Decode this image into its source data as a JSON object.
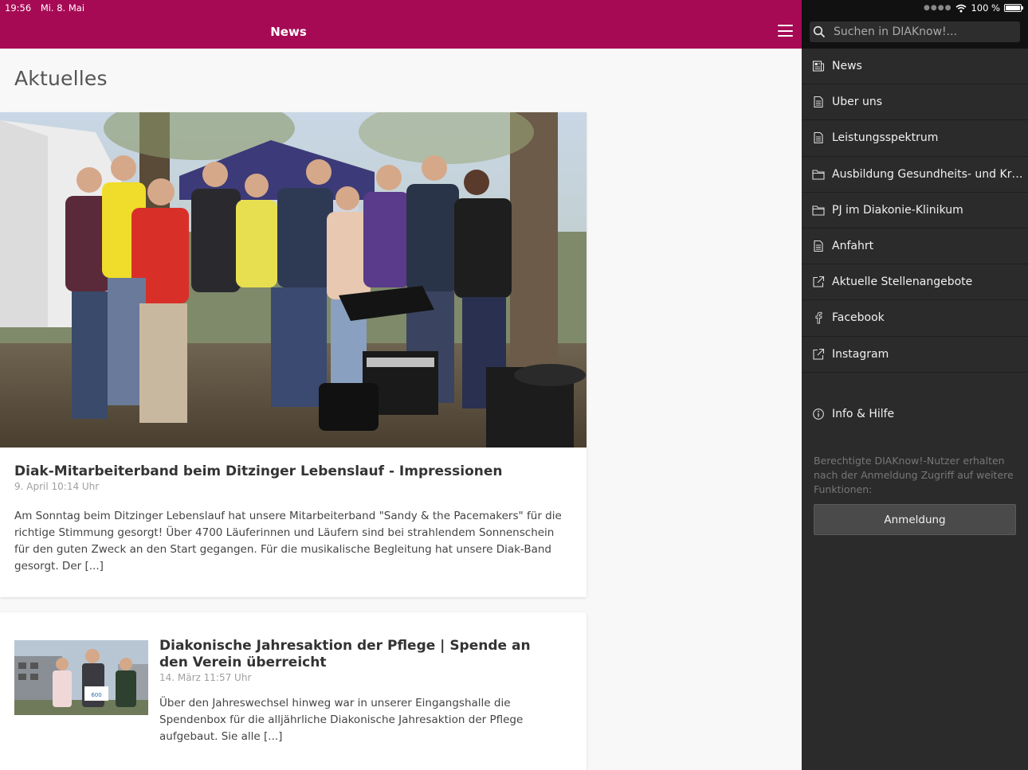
{
  "status_bar": {
    "time": "19:56",
    "date": "Mi. 8. Mai",
    "battery": "100 %"
  },
  "header": {
    "title": "News"
  },
  "page": {
    "heading": "Aktuelles"
  },
  "articles": [
    {
      "title": "Diak-Mitarbeiterband beim Ditzinger Lebenslauf - Impressionen",
      "date": "9. April 10:14 Uhr",
      "excerpt": "Am Sonntag beim Ditzinger Lebenslauf hat unsere Mitarbeiterband \"Sandy & the Pacemakers\" für die richtige Stimmung gesorgt! Über 4700 Läuferinnen und Läufern sind bei strahlendem Sonnenschein für den guten Zweck an den Start gegangen. Für die musikalische Begleitung hat unsere Diak-Band gesorgt. Der [...]"
    },
    {
      "title": "Diakonische Jahresaktion der Pflege | Spende an den Verein überreicht",
      "date": "14. März 11:57 Uhr",
      "excerpt": "Über den Jahreswechsel hinweg war in unserer Eingangshalle die Spendenbox für die alljährliche Diakonische Jahresaktion der Pflege aufgebaut. Sie alle [...]"
    }
  ],
  "drawer": {
    "search_placeholder": "Suchen in DIAKnow!...",
    "menu": [
      {
        "label": "News",
        "icon": "newspaper-icon"
      },
      {
        "label": "Über uns",
        "icon": "document-icon"
      },
      {
        "label": "Leistungsspektrum",
        "icon": "document-icon"
      },
      {
        "label": "Ausbildung Gesundheits- und Kran...",
        "icon": "folder-icon"
      },
      {
        "label": "PJ im Diakonie-Klinikum",
        "icon": "folder-icon"
      },
      {
        "label": "Anfahrt",
        "icon": "document-icon"
      },
      {
        "label": "Aktuelle Stellenangebote",
        "icon": "external-link-icon"
      },
      {
        "label": "Facebook",
        "icon": "facebook-icon"
      },
      {
        "label": "Instagram",
        "icon": "external-link-icon"
      }
    ],
    "info_label": "Info & Hilfe",
    "login_note": "Berechtigte DIAKnow!-Nutzer erhalten nach der Anmeldung Zugriff auf weitere Funktionen:",
    "login_button": "Anmeldung"
  },
  "colors": {
    "brand": "#a60a55",
    "drawer_bg": "#2b2b2b"
  }
}
